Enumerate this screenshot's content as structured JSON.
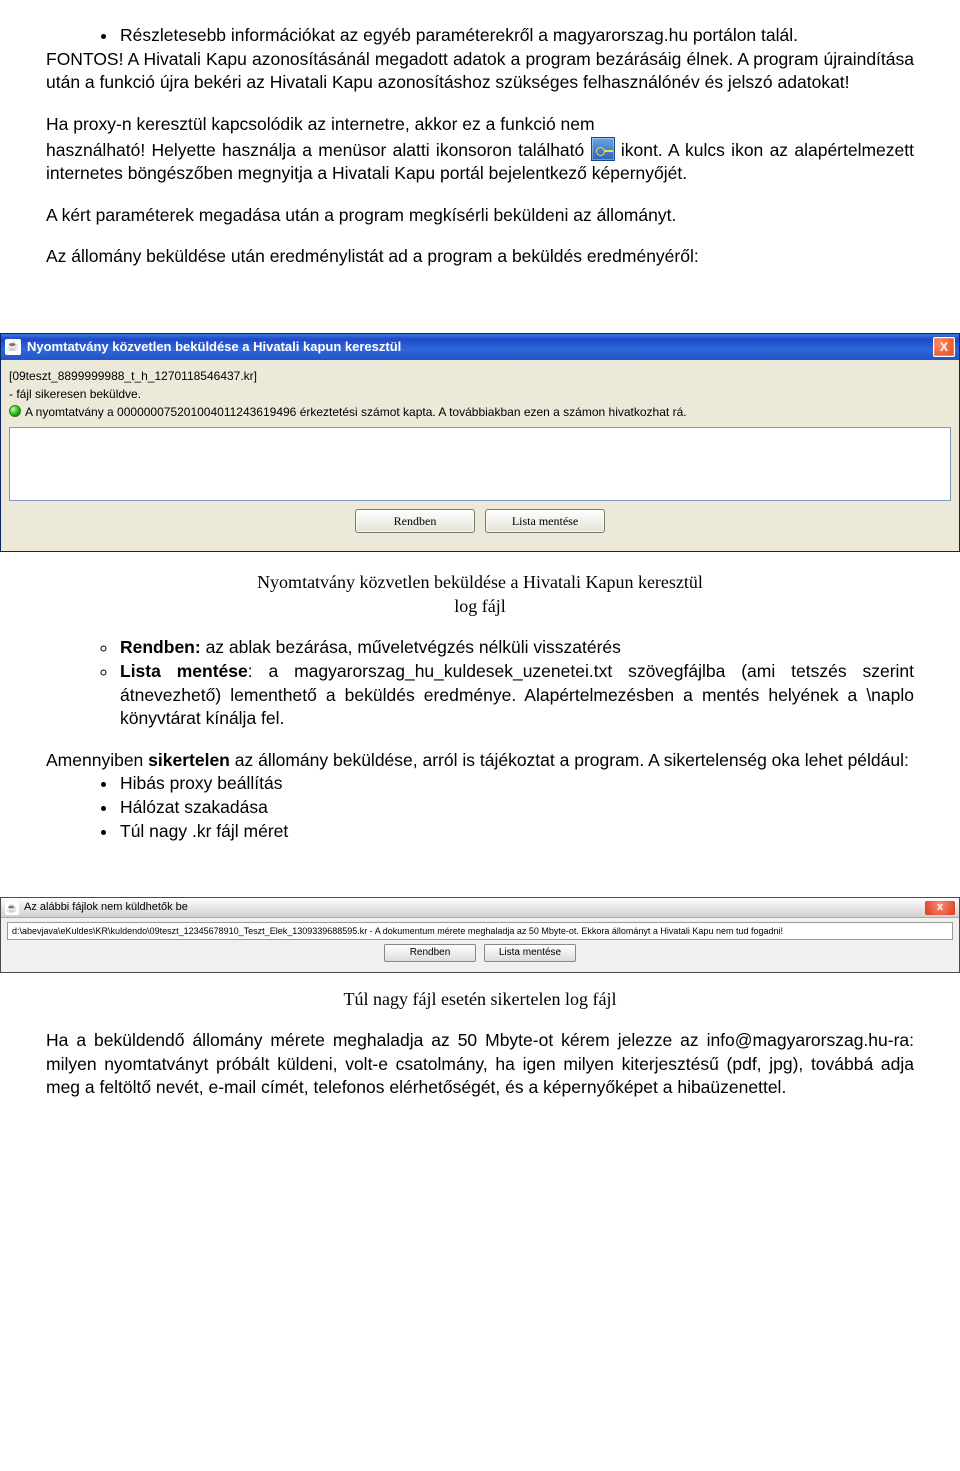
{
  "bul1": {
    "a": "Részletesebb információkat az egyéb paraméterekről a magyarorszag.hu portálon talál."
  },
  "p_fontos_lead": "FONTOS!",
  "p_fontos_rest": " A Hivatali Kapu azonosításánál megadott adatok a program bezárásáig élnek. A program újraindítása után a funkció újra bekéri az Hivatali Kapu azonosításhoz szükséges felhasználónév és jelszó adatokat!",
  "p_proxy1": "Ha proxy-n keresztül kapcsolódik az internetre, akkor ez a funkció nem",
  "p_proxy2a": "használható! Helyette használja a menüsor alatti ikonsoron található ",
  "p_proxy2b": " ikont. A kulcs ikon az alapértelmezett internetes böngészőben megnyitja a Hivatali Kapu portál bejelentkező képernyőjét.",
  "p_kert": "A kért paraméterek megadása után a program megkísérli beküldeni az állományt.",
  "p_eredm": "Az állomány beküldése után eredménylistát ad a program a beküldés eredményéről:",
  "dialog1": {
    "title": "Nyomtatvány közvetlen beküldése a Hivatali kapun keresztül",
    "close": "X",
    "line1": "[09teszt_8899999988_t_h_1270118546437.kr]",
    "line2": "- fájl sikeresen beküldve.",
    "line3": "A nyomtatvány a 000000075201004011243619496 érkeztetési számot kapta. A továbbiakban ezen a számon hivatkozhat rá.",
    "btn_ok": "Rendben",
    "btn_save": "Lista mentése"
  },
  "caption1_l1": "Nyomtatvány közvetlen beküldése a Hivatali Kapun keresztül",
  "caption1_l2": "log fájl",
  "sub": {
    "rendben_lead": "Rendben:",
    "rendben_rest": " az ablak bezárása, műveletvégzés nélküli visszatérés",
    "lista_lead": "Lista mentése",
    "lista_rest": ": a magyarorszag_hu_kuldesek_uzenetei.txt szövegfájlba (ami tetszés szerint átnevezhető) lementhető a beküldés eredménye. Alapértelmezésben a mentés helyének a \\naplo könyvtárat kínálja fel."
  },
  "p_sikertelen_a": "Amennyiben ",
  "p_sikertelen_b": "sikertelen",
  "p_sikertelen_c": " az állomány beküldése, arról is tájékoztat a program. A sikertelenség oka lehet például:",
  "bul2": {
    "a": "Hibás proxy beállítás",
    "b": "Hálózat szakadása",
    "c": "Túl nagy .kr fájl méret"
  },
  "dialog2": {
    "title": "Az alábbi fájlok nem küldhetők be",
    "close": "x",
    "msg": "d:\\abevjava\\eKuldes\\KR\\kuldendo\\09teszt_12345678910_Teszt_Elek_1309339688595.kr - A dokumentum mérete meghaladja az 50 Mbyte-ot. Ekkora állományt a Hivatali Kapu nem tud fogadni!",
    "btn_ok": "Rendben",
    "btn_save": "Lista mentése"
  },
  "caption2": "Túl nagy fájl esetén sikertelen log fájl",
  "p_last": "Ha a beküldendő állomány mérete meghaladja az 50 Mbyte-ot kérem jelezze az info@magyarorszag.hu-ra: milyen nyomtatványt próbált küldeni, volt-e csatolmány, ha igen milyen kiterjesztésű (pdf, jpg), továbbá adja meg a feltöltő nevét, e-mail címét, telefonos elérhetőségét, és a képernyőképet a hibaüzenettel."
}
